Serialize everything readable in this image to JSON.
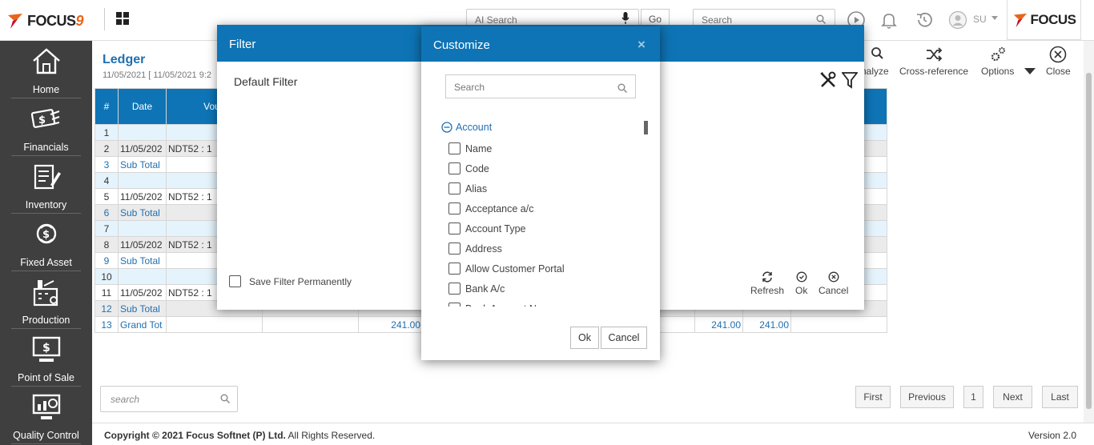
{
  "topbar": {
    "logo_text": "FOCUS",
    "logo_number": "9",
    "ai_search_placeholder": "AI Search",
    "go_label": "Go",
    "search_placeholder": "Search",
    "user_initials": "SU",
    "brand_text": "FOCUS"
  },
  "sidebar": {
    "items": [
      {
        "label": "Home",
        "icon": "home-icon"
      },
      {
        "label": "Financials",
        "icon": "financials-icon"
      },
      {
        "label": "Inventory",
        "icon": "inventory-icon"
      },
      {
        "label": "Fixed Asset",
        "icon": "fixed-asset-icon"
      },
      {
        "label": "Production",
        "icon": "production-icon"
      },
      {
        "label": "Point of Sale",
        "icon": "point-of-sale-icon"
      },
      {
        "label": "Quality Control",
        "icon": "quality-control-icon"
      }
    ]
  },
  "ledger": {
    "title": "Ledger",
    "date_range": "11/05/2021 [ 11/05/2021 9:2"
  },
  "toolbar": {
    "analyze_label": "nalyze",
    "cross_reference_label": "Cross-reference",
    "options_label": "Options",
    "close_label": "Close"
  },
  "table": {
    "headers": [
      "#",
      "Date",
      "Vouc"
    ],
    "rows": [
      {
        "n": "1",
        "date": "",
        "voucher": "",
        "type": "blue",
        "val1": "",
        "val2": "",
        "val3": ""
      },
      {
        "n": "2",
        "date": "11/05/202",
        "voucher": "NDT52 : 1",
        "type": "grey",
        "val1": "",
        "val2": "",
        "val3": ""
      },
      {
        "n": "3",
        "date": "Sub Total",
        "voucher": "",
        "type": "sub",
        "val1": "",
        "val2": "",
        "val3": ""
      },
      {
        "n": "4",
        "date": "",
        "voucher": "",
        "type": "blue",
        "val1": "",
        "val2": "",
        "val3": ""
      },
      {
        "n": "5",
        "date": "11/05/202",
        "voucher": "NDT52 : 1",
        "type": "plain",
        "val1": "",
        "val2": "",
        "val3": ""
      },
      {
        "n": "6",
        "date": "Sub Total",
        "voucher": "",
        "type": "subgrey",
        "val1": "",
        "val2": "",
        "val3": ""
      },
      {
        "n": "7",
        "date": "",
        "voucher": "",
        "type": "blue",
        "val1": "",
        "val2": "",
        "val3": ""
      },
      {
        "n": "8",
        "date": "11/05/202",
        "voucher": "NDT52 : 1",
        "type": "grey",
        "val1": "",
        "val2": "",
        "val3": ""
      },
      {
        "n": "9",
        "date": "Sub Total",
        "voucher": "",
        "type": "sub",
        "val1": "",
        "val2": "",
        "val3": ""
      },
      {
        "n": "10",
        "date": "",
        "voucher": "",
        "type": "blue",
        "val1": "",
        "val2": "",
        "val3": ""
      },
      {
        "n": "11",
        "date": "11/05/202",
        "voucher": "NDT52 : 1",
        "type": "plain",
        "val1": "",
        "val2": "",
        "val3": ""
      },
      {
        "n": "12",
        "date": "Sub Total",
        "voucher": "",
        "type": "subgrey",
        "val1": "",
        "val2": "",
        "val3": ""
      },
      {
        "n": "13",
        "date": "Grand Tot",
        "voucher": "",
        "type": "sub",
        "val1": "241.00",
        "val2": "241.00",
        "val3": "241.00"
      }
    ]
  },
  "bottom": {
    "search_placeholder": "search",
    "first": "First",
    "previous": "Previous",
    "page": "1",
    "next": "Next",
    "last": "Last"
  },
  "footer": {
    "copyright_bold": "Copyright © 2021 Focus Softnet (P) Ltd.",
    "copyright_rest": " All Rights Reserved.",
    "version": "Version 2.0"
  },
  "filter_dialog": {
    "title": "Filter",
    "default_filter": "Default Filter",
    "save_permanently": "Save Filter Permanently",
    "refresh": "Refresh",
    "ok": "Ok",
    "cancel": "Cancel"
  },
  "customize_dialog": {
    "title": "Customize",
    "close": "×",
    "search_placeholder": "Search",
    "group": "Account",
    "fields": [
      "Name",
      "Code",
      "Alias",
      "Acceptance a/c",
      "Account Type",
      "Address",
      "Allow Customer Portal",
      "Bank A/c",
      "Bank Account Name"
    ],
    "ok": "Ok",
    "cancel": "Cancel"
  },
  "colors": {
    "primary": "#0e74b5",
    "sidebar": "#3f3f3f",
    "link": "#1f6fb2",
    "accent_orange": "#e8651a"
  }
}
